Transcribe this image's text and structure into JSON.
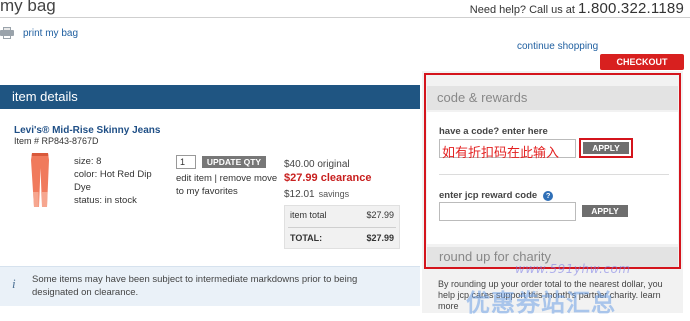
{
  "header": {
    "title": "my bag",
    "help_text": "Need help? Call us at",
    "phone": "1.800.322.1189",
    "print_label": "print my bag",
    "continue_label": "continue shopping",
    "checkout_label": "CHECKOUT"
  },
  "item_details": {
    "header": "item details",
    "product_name": "Levi's® Mid-Rise Skinny Jeans",
    "item_number": "Item # RP843-8767D",
    "size": "size: 8",
    "color": "color: Hot Red Dip Dye",
    "status": "status: in stock",
    "quantity": "1",
    "update_label": "UPDATE QTY",
    "edit_links": "edit item | remove move to my favorites",
    "original_price": "$40.00 original",
    "clearance_price": "$27.99 clearance",
    "savings_value": "$12.01",
    "savings_label": "savings",
    "item_total_label": "item total",
    "item_total_value": "$27.99",
    "total_label": "TOTAL:",
    "total_value": "$27.99"
  },
  "notice": {
    "text": "Some items may have been subject to intermediate markdowns prior to being designated on clearance."
  },
  "codes": {
    "header": "code & rewards",
    "code_label": "have a code? enter here",
    "code_note": "如有折扣码在此输入",
    "apply_label": "APPLY",
    "reward_label": "enter jcp reward code",
    "reward_help": "?",
    "apply2_label": "APPLY"
  },
  "roundup": {
    "header": "round up for charity",
    "text": "By rounding up your order total to the nearest dollar, you help jcp cares support this month's partner charity. learn more"
  },
  "watermark": {
    "url": "www.591yhw.com",
    "text": "优惠券站汇总"
  },
  "colors": {
    "brand_blue": "#1f5582",
    "checkout_red": "#d8201f",
    "clearance_red": "#c8201f",
    "highlight_red": "#d4141c",
    "jeans": "#f07a5c"
  },
  "icons": {
    "print": "printer-icon",
    "info": "info-icon",
    "help": "help-circle-icon",
    "product": "jeans-thumbnail"
  }
}
